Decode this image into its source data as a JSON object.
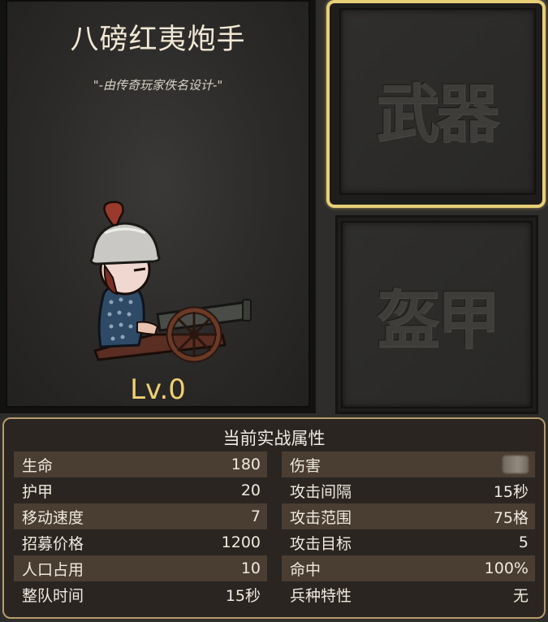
{
  "unit": {
    "name": "八磅红夷炮手",
    "designer_credit": "\"-由传奇玩家佚名设计-\"",
    "level": "Lv.0"
  },
  "equipment": {
    "weapon_slot_label": "武器",
    "armor_slot_label": "盔甲"
  },
  "stats": {
    "title": "当前实战属性",
    "left": [
      {
        "label": "生命",
        "value": "180"
      },
      {
        "label": "护甲",
        "value": "20"
      },
      {
        "label": "移动速度",
        "value": "7"
      },
      {
        "label": "招募价格",
        "value": "1200"
      },
      {
        "label": "人口占用",
        "value": "10"
      },
      {
        "label": "整队时间",
        "value": "15秒"
      }
    ],
    "right": [
      {
        "label": "伤害",
        "value": ""
      },
      {
        "label": "攻击间隔",
        "value": "15秒"
      },
      {
        "label": "攻击范围",
        "value": "75格"
      },
      {
        "label": "攻击目标",
        "value": "5"
      },
      {
        "label": "命中",
        "value": "100%"
      },
      {
        "label": "兵种特性",
        "value": "无"
      }
    ]
  },
  "colors": {
    "level_text": "#f0d070",
    "selected_slot_border": "#e7cf78",
    "stats_border": "#b79b6c",
    "shaded_row": "#4a3d31"
  }
}
